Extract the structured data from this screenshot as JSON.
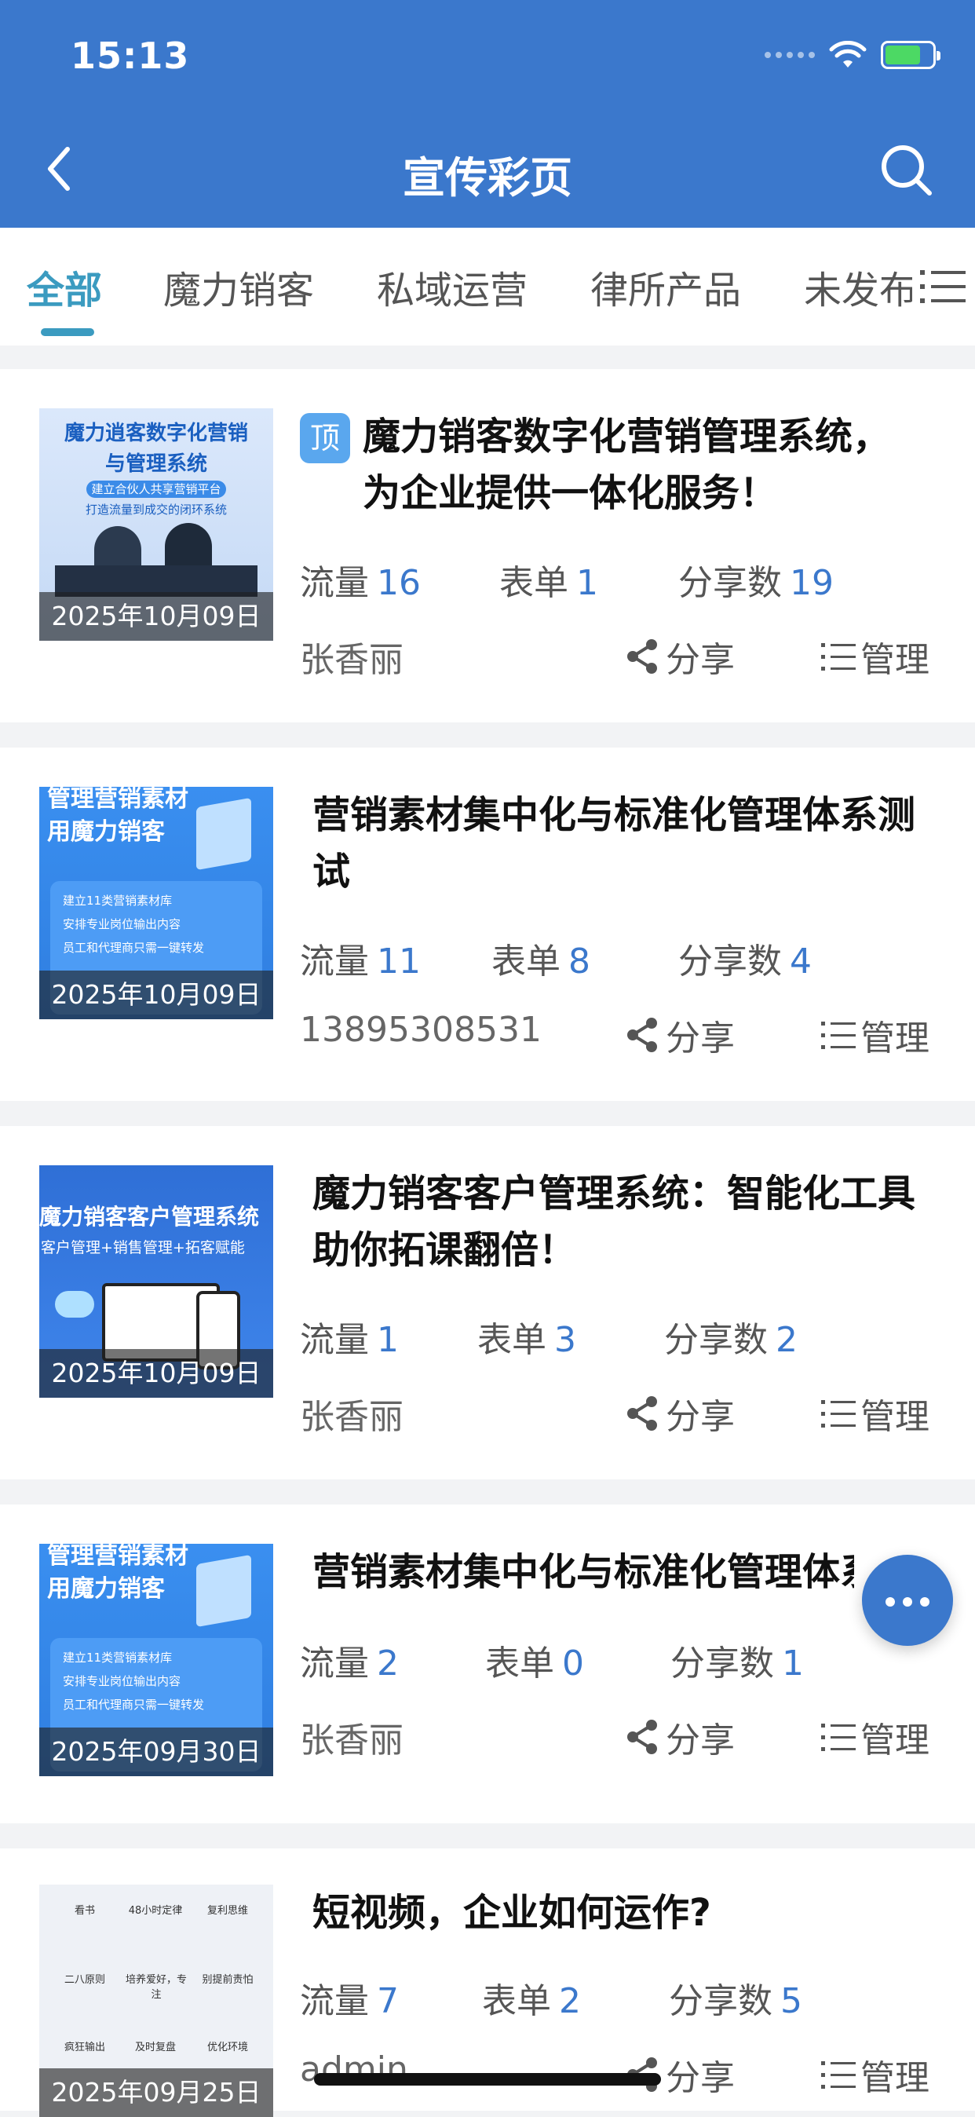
{
  "status": {
    "time": "15:13"
  },
  "nav": {
    "title": "宣传彩页"
  },
  "tabs": [
    {
      "label": "全部",
      "active": true
    },
    {
      "label": "魔力销客",
      "active": false
    },
    {
      "label": "私域运营",
      "active": false
    },
    {
      "label": "律所产品",
      "active": false
    },
    {
      "label": "未发布",
      "active": false
    }
  ],
  "labels": {
    "traffic": "流量",
    "form": "表单",
    "shares": "分享数",
    "share_btn": "分享",
    "manage_btn": "管理",
    "pin": "顶"
  },
  "items": [
    {
      "title": "魔力销客数字化营销管理系统，为企业提供一体化服务！",
      "pinned": true,
      "date": "2025年10月09日",
      "traffic": "16",
      "form": "1",
      "shares": "19",
      "author": "张香丽",
      "thumb_lines": [
        "魔力逍客数字化营销",
        "与管理系统",
        "建立合伙人共享营销平台",
        "打造流量到成交的闭环系统"
      ]
    },
    {
      "title": "营销素材集中化与标准化管理体系测试",
      "pinned": false,
      "date": "2025年10月09日",
      "traffic": "11",
      "form": "8",
      "shares": "4",
      "author": "13895308531",
      "thumb_lines": [
        "管理营销素材",
        "用魔力销客",
        "建立11类营销素材库",
        "安排专业岗位输出内容",
        "员工和代理商只需一键转发"
      ]
    },
    {
      "title": "魔力销客客户管理系统：智能化工具助你拓课翻倍！",
      "pinned": false,
      "date": "2025年10月09日",
      "traffic": "1",
      "form": "3",
      "shares": "2",
      "author": "张香丽",
      "thumb_lines": [
        "魔力销客客户管理系统",
        "客户管理+销售管理+拓客赋能"
      ]
    },
    {
      "title": "营销素材集中化与标准化管理体系",
      "pinned": false,
      "date": "2025年09月30日",
      "traffic": "2",
      "form": "0",
      "shares": "1",
      "author": "张香丽",
      "thumb_lines": [
        "管理营销素材",
        "用魔力销客",
        "建立11类营销素材库",
        "安排专业岗位输出内容",
        "员工和代理商只需一键转发"
      ]
    },
    {
      "title": "短视频，企业如何运作?",
      "pinned": false,
      "date": "2025年09月25日",
      "traffic": "7",
      "form": "2",
      "shares": "5",
      "author": "admin",
      "thumb_lines": [
        "看书",
        "48小时定律",
        "复利思维",
        "二八原则",
        "培养爱好，专注",
        "别提前责怕",
        "疯狂输出",
        "及时复盘",
        "优化环境"
      ]
    }
  ],
  "colors": {
    "primary": "#3b78cc",
    "tab_active": "#3b9bc0",
    "number": "#3b78cc"
  }
}
